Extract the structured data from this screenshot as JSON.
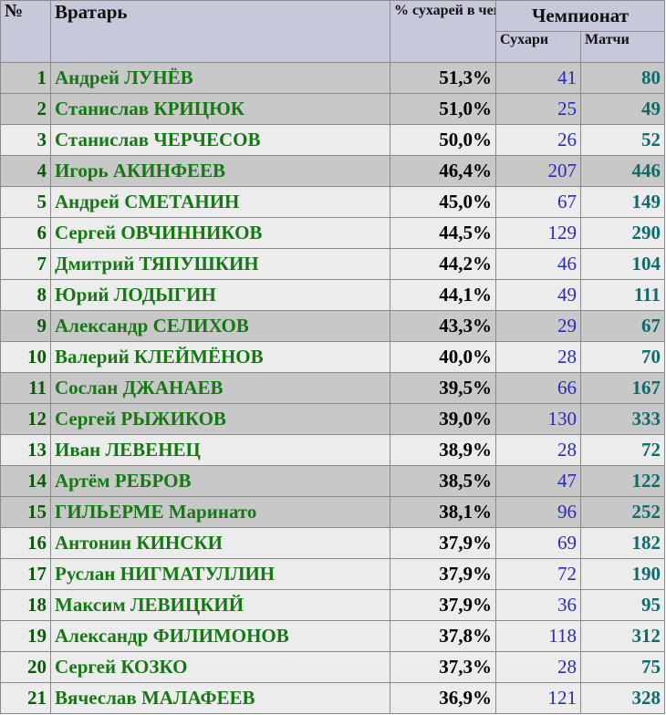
{
  "header": {
    "num": "№",
    "goalkeeper": "Вратарь",
    "pct": "% сухарей в чемпионате",
    "championship": "Чемпионат",
    "clean_sheets": "Сухари",
    "matches": "Матчи"
  },
  "rows": [
    {
      "num": "1",
      "name": "Андрей ЛУНЁВ",
      "pct": "51,3%",
      "clean": "41",
      "matches": "80",
      "shade": "dark"
    },
    {
      "num": "2",
      "name": "Станислав КРИЦЮК",
      "pct": "51,0%",
      "clean": "25",
      "matches": "49",
      "shade": "dark"
    },
    {
      "num": "3",
      "name": "Станислав ЧЕРЧЕСОВ",
      "pct": "50,0%",
      "clean": "26",
      "matches": "52",
      "shade": "light"
    },
    {
      "num": "4",
      "name": "Игорь АКИНФЕЕВ",
      "pct": "46,4%",
      "clean": "207",
      "matches": "446",
      "shade": "dark"
    },
    {
      "num": "5",
      "name": "Андрей СМЕТАНИН",
      "pct": "45,0%",
      "clean": "67",
      "matches": "149",
      "shade": "light"
    },
    {
      "num": "6",
      "name": "Сергей ОВЧИННИКОВ",
      "pct": "44,5%",
      "clean": "129",
      "matches": "290",
      "shade": "light"
    },
    {
      "num": "7",
      "name": "Дмитрий ТЯПУШКИН",
      "pct": "44,2%",
      "clean": "46",
      "matches": "104",
      "shade": "light"
    },
    {
      "num": "8",
      "name": "Юрий ЛОДЫГИН",
      "pct": "44,1%",
      "clean": "49",
      "matches": "111",
      "shade": "light"
    },
    {
      "num": "9",
      "name": "Александр СЕЛИХОВ",
      "pct": "43,3%",
      "clean": "29",
      "matches": "67",
      "shade": "dark"
    },
    {
      "num": "10",
      "name": "Валерий КЛЕЙМЁНОВ",
      "pct": "40,0%",
      "clean": "28",
      "matches": "70",
      "shade": "light"
    },
    {
      "num": "11",
      "name": "Сослан ДЖАНАЕВ",
      "pct": "39,5%",
      "clean": "66",
      "matches": "167",
      "shade": "dark"
    },
    {
      "num": "12",
      "name": "Сергей РЫЖИКОВ",
      "pct": "39,0%",
      "clean": "130",
      "matches": "333",
      "shade": "dark"
    },
    {
      "num": "13",
      "name": "Иван ЛЕВЕНЕЦ",
      "pct": "38,9%",
      "clean": "28",
      "matches": "72",
      "shade": "light"
    },
    {
      "num": "14",
      "name": "Артём РЕБРОВ",
      "pct": "38,5%",
      "clean": "47",
      "matches": "122",
      "shade": "dark"
    },
    {
      "num": "15",
      "name": "ГИЛЬЕРМЕ Маринато",
      "pct": "38,1%",
      "clean": "96",
      "matches": "252",
      "shade": "dark"
    },
    {
      "num": "16",
      "name": "Антонин КИНСКИ",
      "pct": "37,9%",
      "clean": "69",
      "matches": "182",
      "shade": "light"
    },
    {
      "num": "17",
      "name": "Руслан НИГМАТУЛЛИН",
      "pct": "37,9%",
      "clean": "72",
      "matches": "190",
      "shade": "light"
    },
    {
      "num": "18",
      "name": "Максим ЛЕВИЦКИЙ",
      "pct": "37,9%",
      "clean": "36",
      "matches": "95",
      "shade": "light"
    },
    {
      "num": "19",
      "name": "Александр ФИЛИМОНОВ",
      "pct": "37,8%",
      "clean": "118",
      "matches": "312",
      "shade": "light"
    },
    {
      "num": "20",
      "name": "Сергей КОЗКО",
      "pct": "37,3%",
      "clean": "28",
      "matches": "75",
      "shade": "light"
    },
    {
      "num": "21",
      "name": "Вячеслав МАЛАФЕЕВ",
      "pct": "36,9%",
      "clean": "121",
      "matches": "328",
      "shade": "light"
    }
  ]
}
